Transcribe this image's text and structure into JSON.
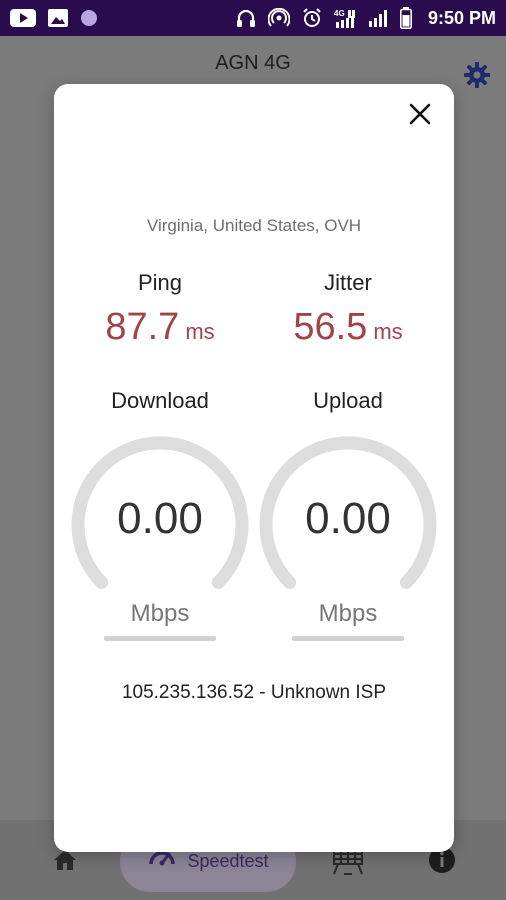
{
  "status_bar": {
    "time": "9:50 PM",
    "left_icons": [
      "youtube-icon",
      "gallery-icon",
      "circle-icon"
    ],
    "right_icons": [
      "headphones-icon",
      "hotspot-icon",
      "alarm-icon",
      "4g-signal-icon",
      "signal-icon",
      "battery-icon"
    ],
    "network_badge": "4G"
  },
  "app": {
    "title": "AGN 4G",
    "bottom_nav": {
      "speedtest_label": "Speedtest"
    }
  },
  "dialog": {
    "server": "Virginia, United States, OVH",
    "ping": {
      "label": "Ping",
      "value": "87.7",
      "unit": "ms"
    },
    "jitter": {
      "label": "Jitter",
      "value": "56.5",
      "unit": "ms"
    },
    "download": {
      "label": "Download",
      "value": "0.00",
      "unit": "Mbps",
      "fraction": 0
    },
    "upload": {
      "label": "Upload",
      "value": "0.00",
      "unit": "Mbps",
      "fraction": 0
    },
    "isp": "105.235.136.52 - Unknown ISP"
  },
  "colors": {
    "status_bar": "#2a0c4e",
    "accent_value": "#a2434a",
    "gauge_track": "#dddddd",
    "nav_active": "#8c8597"
  }
}
